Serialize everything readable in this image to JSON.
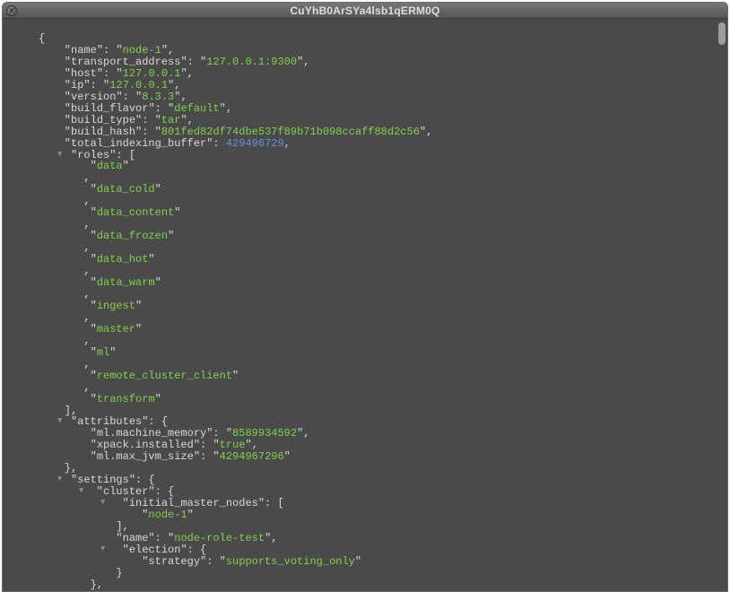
{
  "window": {
    "title": "CuYhB0ArSYa4lsb1qERM0Q"
  },
  "json": {
    "name": "node-1",
    "transport_address": "127.0.0.1:9300",
    "host": "127.0.0.1",
    "ip": "127.0.0.1",
    "version": "8.3.3",
    "build_flavor": "default",
    "build_type": "tar",
    "build_hash": "801fed82df74dbe537f89b71b098ccaff88d2c56",
    "total_indexing_buffer": 429496729,
    "roles": [
      "data",
      "data_cold",
      "data_content",
      "data_frozen",
      "data_hot",
      "data_warm",
      "ingest",
      "master",
      "ml",
      "remote_cluster_client",
      "transform"
    ],
    "attributes": {
      "ml.machine_memory": "8589934592",
      "xpack.installed": "true",
      "ml.max_jvm_size": "4294967296"
    },
    "settings": {
      "cluster": {
        "initial_master_nodes": [
          "node-1"
        ],
        "name": "node-role-test",
        "election": {
          "strategy": "supports_voting_only"
        }
      }
    }
  },
  "toggle_glyph": "▼"
}
